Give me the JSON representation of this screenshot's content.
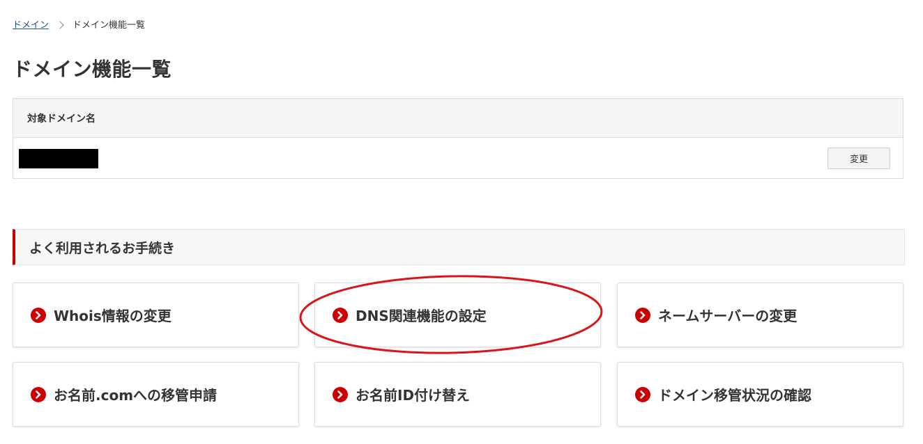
{
  "breadcrumb": {
    "items": [
      "ドメイン",
      "ドメイン機能一覧"
    ]
  },
  "page_title": "ドメイン機能一覧",
  "domain_table": {
    "header": "対象ドメイン名",
    "domain_value": "",
    "change_button": "変更"
  },
  "section": {
    "title": "よく利用されるお手続き"
  },
  "cards": [
    {
      "label": "Whois情報の変更",
      "icon": "chevron-right-icon"
    },
    {
      "label": "DNS関連機能の設定",
      "icon": "chevron-right-icon"
    },
    {
      "label": "ネームサーバーの変更",
      "icon": "chevron-right-icon"
    },
    {
      "label": "お名前.comへの移管申請",
      "icon": "chevron-right-icon"
    },
    {
      "label": "お名前ID付け替え",
      "icon": "chevron-right-icon"
    },
    {
      "label": "ドメイン移管状況の確認",
      "icon": "chevron-right-icon"
    }
  ],
  "colors": {
    "accent": "#cc0000",
    "link": "#1a4e9a",
    "annotation": "#d9141b"
  }
}
